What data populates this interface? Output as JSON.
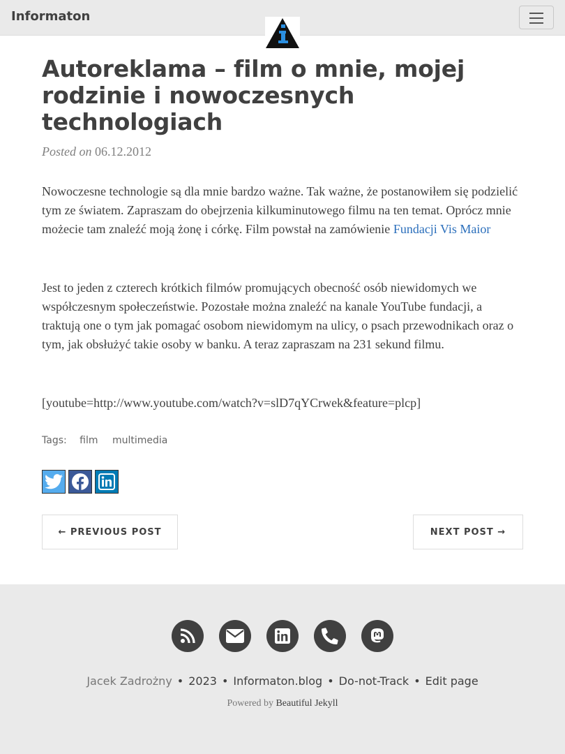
{
  "navbar": {
    "brand": "Informaton",
    "logo_icon": "informaton-info-triangle-logo",
    "menu_icon": "hamburger-menu-icon"
  },
  "post": {
    "title": "Autoreklama – film o mnie, mojej rodzinie i nowoczesnych technologiach",
    "posted_on_label": "Posted on",
    "date": "06.12.2012",
    "paragraph1_text": "Nowoczesne technologie są dla mnie bardzo ważne. Tak ważne, że postanowiłem się podzielić tym ze światem. Zapraszam do obejrzenia kilkuminutowego filmu na ten temat. Oprócz mnie możecie tam znaleźć moją żonę i córkę. Film powstał na zamówienie",
    "paragraph1_link": "Fundacji Vis Maior",
    "paragraph2": "Jest to jeden z czterech krótkich filmów promujących obecność osób niewidomych we współczesnym społeczeństwie. Pozostałe można znaleźć na kanale YouTube fundacji, a traktują one o tym jak pomagać osobom niewidomym na ulicy, o psach przewodnikach oraz o tym, jak obsłużyć takie osoby w banku. A teraz zapraszam na 231 sekund filmu.",
    "paragraph3": "[youtube=http://www.youtube.com/watch?v=slD7qYCrwek&feature=plcp]",
    "tags_label": "Tags:",
    "tags": [
      "film",
      "multimedia"
    ]
  },
  "share": {
    "icons": [
      "twitter-icon",
      "facebook-icon",
      "linkedin-icon"
    ],
    "colors": {
      "twitter": "#55acee",
      "facebook": "#3b5998",
      "linkedin": "#007bb5"
    }
  },
  "pager": {
    "previous": "← PREVIOUS POST",
    "next": "NEXT POST →"
  },
  "footer": {
    "social_icons": [
      "rss-icon",
      "envelope-icon",
      "linkedin-icon",
      "phone-icon",
      "mastodon-icon"
    ],
    "author": "Jacek Zadrożny",
    "year": "2023",
    "site": "Informaton.blog",
    "dnt": "Do-not-Track",
    "edit": "Edit page",
    "powered_by": "Powered by",
    "theme": "Beautiful Jekyll",
    "separator": "•"
  }
}
